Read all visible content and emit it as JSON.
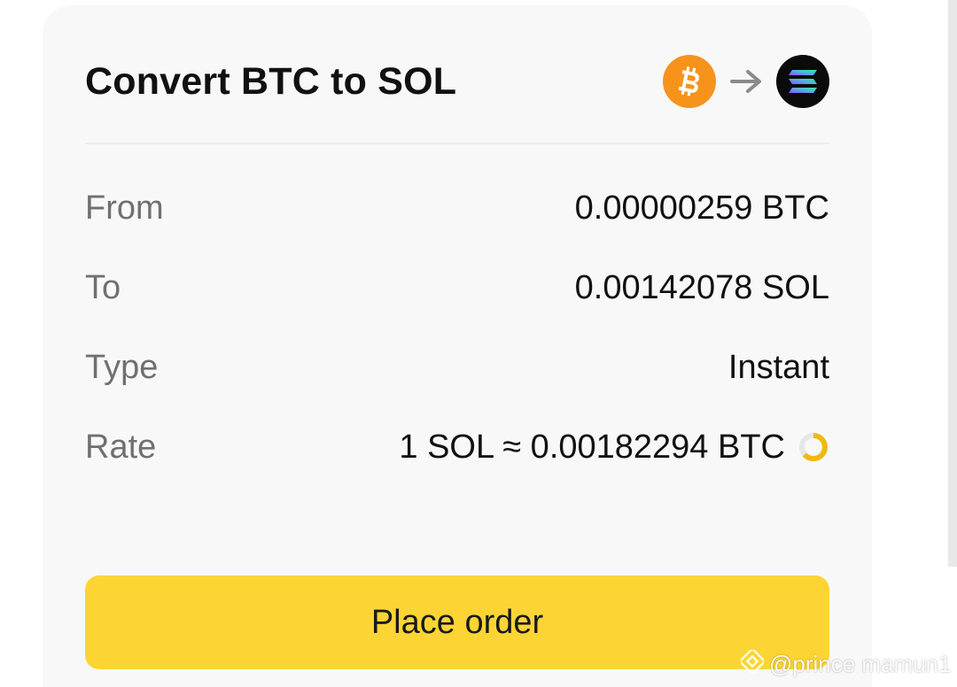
{
  "convert": {
    "title": "Convert BTC to SOL",
    "from_icon": "bitcoin-icon",
    "arrow_icon": "arrow-right-icon",
    "to_icon": "solana-icon"
  },
  "details": {
    "from": {
      "label": "From",
      "value": "0.00000259 BTC"
    },
    "to": {
      "label": "To",
      "value": "0.00142078 SOL"
    },
    "type": {
      "label": "Type",
      "value": "Instant"
    },
    "rate": {
      "label": "Rate",
      "value": "1 SOL ≈ 0.00182294 BTC",
      "refresh_icon": "refresh-countdown-icon"
    }
  },
  "actions": {
    "place_order_label": "Place order"
  },
  "watermark": {
    "text": "@prince mamun1",
    "icon": "binance-logo-icon"
  },
  "colors": {
    "accent": "#fcd535",
    "bitcoin": "#f7931a",
    "solana_bg": "#0b0b0b",
    "card_bg": "#f8f8f8",
    "label": "#707070",
    "text": "#111111"
  }
}
